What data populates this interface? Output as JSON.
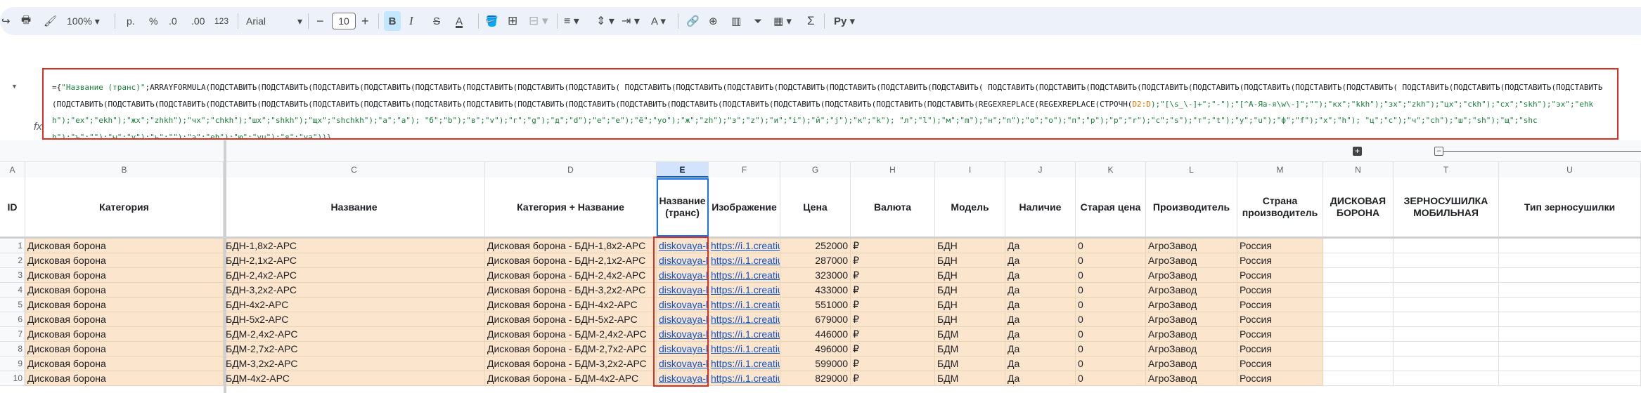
{
  "toolbar": {
    "zoom": "100%",
    "currency": "р.",
    "percent": "%",
    "dec_less": ".0",
    "dec_more": ".00",
    "number_format": "123",
    "font": "Arial",
    "font_size": "10",
    "bold": "B",
    "italic": "I",
    "text_color": "A",
    "sigma": "Σ"
  },
  "formula": {
    "prefix": "={",
    "header_str": "\"Название (транс)\"",
    "body1": ";ARRAYFORMULA(ПОДСТАВИТЬ(ПОДСТАВИТЬ(ПОДСТАВИТЬ(ПОДСТАВИТЬ(ПОДСТАВИТЬ(ПОДСТАВИТЬ(ПОДСТАВИТЬ(ПОДСТАВИТЬ( ПОДСТАВИТЬ(ПОДСТАВИТЬ(ПОДСТАВИТЬ(ПОДСТАВИТЬ(ПОДСТАВИТЬ(ПОДСТАВИТЬ(ПОДСТАВИТЬ( ПОДСТАВИТЬ(ПОДСТАВИТЬ(ПОДСТАВИТЬ(ПОДСТАВИТЬ(ПОДСТАВИТЬ(ПОДСТАВИТЬ(ПОДСТАВИТЬ(ПОДСТАВИТЬ( ПОДСТАВИТЬ(ПОДСТАВИТЬ(ПОДСТАВИТЬ(ПОДСТАВИТЬ(ПОДСТАВИТЬ(ПОДСТАВИТЬ(ПОДСТАВИТЬ(ПОДСТАВИТЬ(ПОДСТАВИТЬ(ПОДСТАВИТЬ(ПОДСТАВИТЬ(ПОДСТАВИТЬ(ПОДСТАВИТЬ(ПОДСТАВИТЬ(ПОДСТАВИТЬ(ПОДСТАВИТЬ(ПОДСТАВИТЬ(ПОДСТАВИТЬ(ПОДСТАВИТЬ(ПОДСТАВИТЬ(ПОДСТАВИТЬ(ПОДСТАВИТЬ(REGEXREPLACE(REGEXREPLACE(СТРОЧН(",
    "ref": "D2:D",
    "body2": ");\"[\\s_\\-]+\";\"-\");\"[^А-Яа-я\\w\\-]\";\"\");\"кх\";\"kkh\");\"зх\";\"zkh\");\"цх\";\"ckh\");\"сх\";\"skh\");\"эх\";\"ehkh\");\"ех\";\"ekh\");\"жх\";\"zhkh\");\"чх\";\"chkh\");\"шх\";\"shkh\");\"щх\";\"shchkh\");\"а\";\"a\"); \"б\";\"b\");\"в\";\"v\");\"г\";\"g\");\"д\";\"d\");\"е\";\"e\");\"ё\";\"yo\");\"ж\";\"zh\");\"з\";\"z\");\"и\";\"i\");\"й\";\"j\");\"к\";\"k\"); \"л\";\"l\");\"м\";\"m\");\"н\";\"n\");\"о\";\"o\");\"п\";\"p\");\"р\";\"r\");\"с\";\"s\");\"т\";\"t\");\"у\";\"u\");\"ф\";\"f\");\"х\";\"h\"); \"ц\";\"c\");\"ч\";\"ch\");\"ш\";\"sh\");\"щ\";\"shch\");\"ъ\";\"\");\"ы\";\"y\");\"ь\";\"\");\"э\";\"eh\");\"ю\";\"yu\");\"я\";\"ya\"))}"
  },
  "columns": [
    "A",
    "B",
    "C",
    "D",
    "E",
    "F",
    "G",
    "H",
    "I",
    "J",
    "K",
    "L",
    "M",
    "N",
    "T",
    "U"
  ],
  "headers": [
    "ID",
    "Категория",
    "Название",
    "Категория + Название",
    "Название (транс)",
    "Изображение",
    "Цена",
    "Валюта",
    "Модель",
    "Наличие",
    "Старая цена",
    "Производитель",
    "Страна производитель",
    "ДИСКОВАЯ БОРОНА",
    "ЗЕРНОСУШИЛКА МОБИЛЬНАЯ",
    "Тип зерносушилки"
  ],
  "rows": [
    {
      "n": "1",
      "cat": "Дисковая борона",
      "name": "БДН-1,8х2-АРС",
      "full": "Дисковая борона - БДН-1,8х2-АРС",
      "trans": "diskovaya-b",
      "img": "https://i.1.creatiu",
      "price": "252000",
      "cur": "₽",
      "model": "БДН",
      "avail": "Да",
      "old": "0",
      "maker": "АгроЗавод",
      "country": "Россия"
    },
    {
      "n": "2",
      "cat": "Дисковая борона",
      "name": "БДН-2,1х2-АРС",
      "full": "Дисковая борона - БДН-2,1х2-АРС",
      "trans": "diskovaya-b",
      "img": "https://i.1.creatiu",
      "price": "287000",
      "cur": "₽",
      "model": "БДН",
      "avail": "Да",
      "old": "0",
      "maker": "АгроЗавод",
      "country": "Россия"
    },
    {
      "n": "3",
      "cat": "Дисковая борона",
      "name": "БДН-2,4х2-АРС",
      "full": "Дисковая борона - БДН-2,4х2-АРС",
      "trans": "diskovaya-b",
      "img": "https://i.1.creatiu",
      "price": "323000",
      "cur": "₽",
      "model": "БДН",
      "avail": "Да",
      "old": "0",
      "maker": "АгроЗавод",
      "country": "Россия"
    },
    {
      "n": "4",
      "cat": "Дисковая борона",
      "name": "БДН-3,2х2-АРС",
      "full": "Дисковая борона - БДН-3,2х2-АРС",
      "trans": "diskovaya-b",
      "img": "https://i.1.creatiu",
      "price": "433000",
      "cur": "₽",
      "model": "БДН",
      "avail": "Да",
      "old": "0",
      "maker": "АгроЗавод",
      "country": "Россия"
    },
    {
      "n": "5",
      "cat": "Дисковая борона",
      "name": "БДН-4х2-АРС",
      "full": "Дисковая борона - БДН-4х2-АРС",
      "trans": "diskovaya-b",
      "img": "https://i.1.creatiu",
      "price": "551000",
      "cur": "₽",
      "model": "БДН",
      "avail": "Да",
      "old": "0",
      "maker": "АгроЗавод",
      "country": "Россия"
    },
    {
      "n": "6",
      "cat": "Дисковая борона",
      "name": "БДН-5х2-АРС",
      "full": "Дисковая борона - БДН-5х2-АРС",
      "trans": "diskovaya-b",
      "img": "https://i.1.creatiu",
      "price": "679000",
      "cur": "₽",
      "model": "БДН",
      "avail": "Да",
      "old": "0",
      "maker": "АгроЗавод",
      "country": "Россия"
    },
    {
      "n": "7",
      "cat": "Дисковая борона",
      "name": "БДМ-2,4х2-АРС",
      "full": "Дисковая борона - БДМ-2,4х2-АРС",
      "trans": "diskovaya-b",
      "img": "https://i.1.creatiu",
      "price": "446000",
      "cur": "₽",
      "model": "БДМ",
      "avail": "Да",
      "old": "0",
      "maker": "АгроЗавод",
      "country": "Россия"
    },
    {
      "n": "8",
      "cat": "Дисковая борона",
      "name": "БДМ-2,7х2-АРС",
      "full": "Дисковая борона - БДМ-2,7х2-АРС",
      "trans": "diskovaya-b",
      "img": "https://i.1.creatiu",
      "price": "496000",
      "cur": "₽",
      "model": "БДМ",
      "avail": "Да",
      "old": "0",
      "maker": "АгроЗавод",
      "country": "Россия"
    },
    {
      "n": "9",
      "cat": "Дисковая борона",
      "name": "БДМ-3,2х2-АРС",
      "full": "Дисковая борона - БДМ-3,2х2-АРС",
      "trans": "diskovaya-b",
      "img": "https://i.1.creatiu",
      "price": "599000",
      "cur": "₽",
      "model": "БДМ",
      "avail": "Да",
      "old": "0",
      "maker": "АгроЗавод",
      "country": "Россия"
    },
    {
      "n": "10",
      "cat": "Дисковая борона",
      "name": "БДМ-4х2-АРС",
      "full": "Дисковая борона - БДМ-4х2-АРС",
      "trans": "diskovaya-b",
      "img": "https://i.1.creatiu",
      "price": "829000",
      "cur": "₽",
      "model": "БДМ",
      "avail": "Да",
      "old": "0",
      "maker": "АгроЗавод",
      "country": "Россия"
    }
  ]
}
